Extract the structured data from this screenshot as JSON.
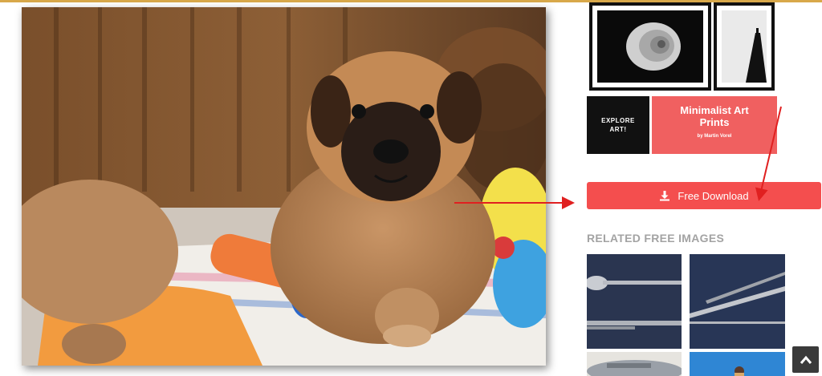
{
  "ad": {
    "explore_line1": "EXPLORE",
    "explore_line2": "ART!",
    "title_line1": "Minimalist Art",
    "title_line2": "Prints",
    "byline": "by Martin Vorel"
  },
  "download": {
    "label": "Free Download",
    "icon": "download-icon"
  },
  "related": {
    "title": "RELATED FREE IMAGES"
  },
  "scroll_top": {
    "icon": "chevron-up-icon"
  },
  "colors": {
    "download_button": "#f44e4e",
    "ad_pink": "#f06060",
    "annotation_arrow": "#e02020",
    "related_title": "#a3a3a3"
  }
}
